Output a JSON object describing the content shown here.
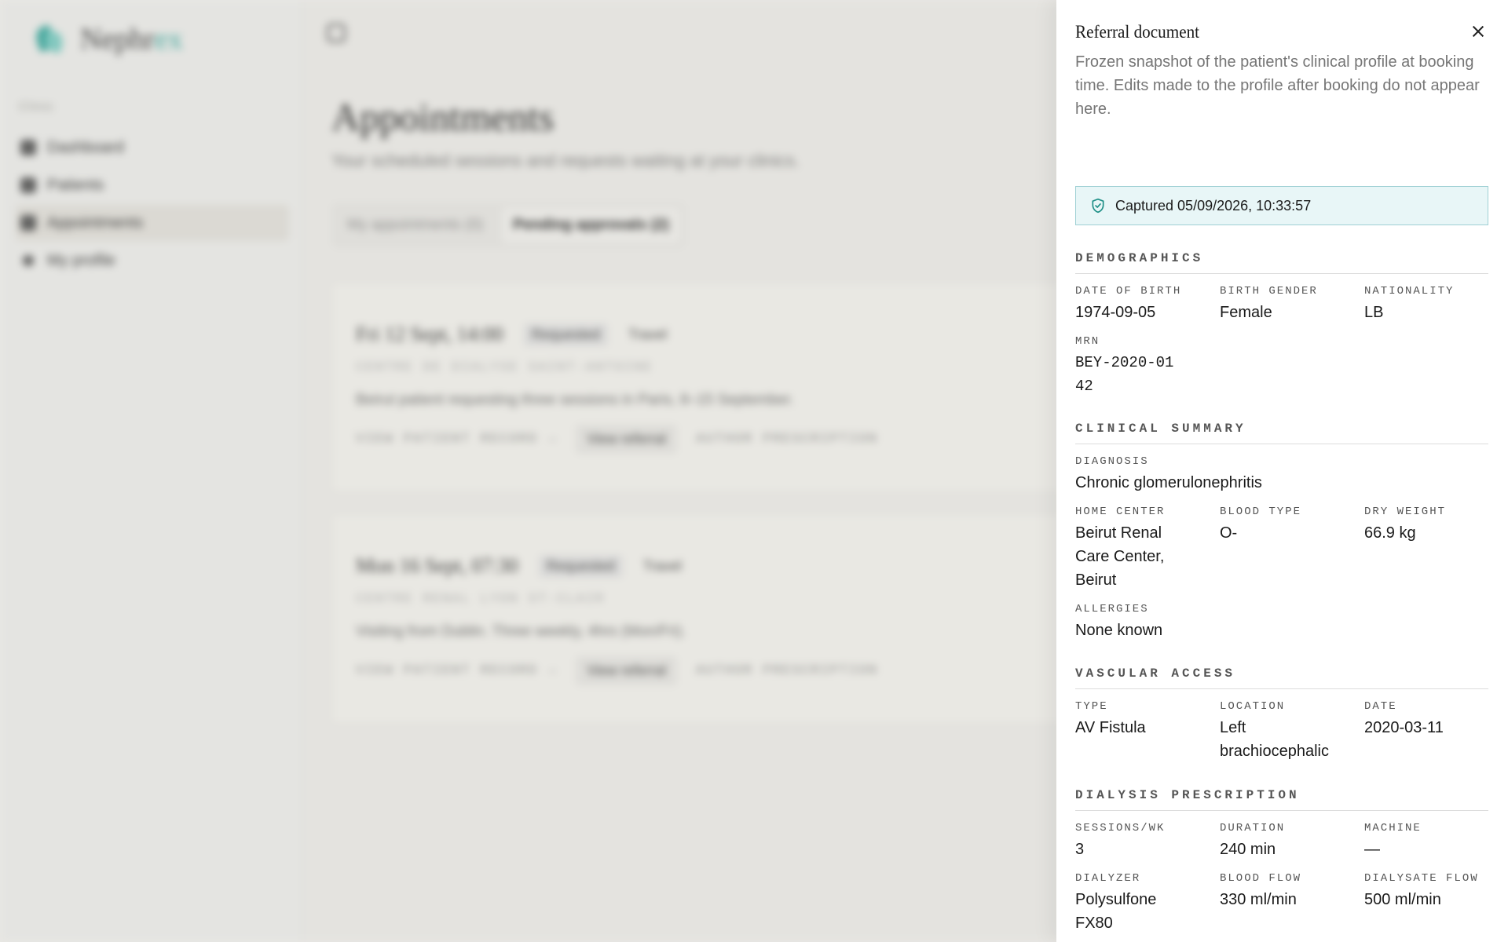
{
  "brand": {
    "name_a": "Nephr",
    "name_b": "ex"
  },
  "sidebar": {
    "group": "Clinic",
    "items": [
      {
        "label": "Dashboard"
      },
      {
        "label": "Patients"
      },
      {
        "label": "Appointments"
      },
      {
        "label": "My profile"
      }
    ]
  },
  "main": {
    "title": "Appointments",
    "subtitle": "Your scheduled sessions and requests waiting at your clinics.",
    "tabs": [
      {
        "label": "My appointments (0)"
      },
      {
        "label": "Pending approvals (2)"
      }
    ],
    "cards": [
      {
        "date": "Fri 12 Sept, 14:00",
        "status": "Requested",
        "tag": "Travel",
        "clinic": "CENTRE DE DIALYSE SAINT-ANTOINE",
        "note": "Beirut patient requesting three sessions in Paris, 8–15 September.",
        "view_record": "VIEW PATIENT RECORD →",
        "view_referral": "View referral",
        "author_prescription": "AUTHOR PRESCRIPTION"
      },
      {
        "date": "Mon 16 Sept, 07:30",
        "status": "Requested",
        "tag": "Travel",
        "clinic": "CENTRE RENAL LYON ST-CLAIR",
        "note": "Visiting from Dublin. Three weekly, 4hrs (Mon/Fri).",
        "view_record": "VIEW PATIENT RECORD →",
        "view_referral": "View referral",
        "author_prescription": "AUTHOR PRESCRIPTION"
      }
    ]
  },
  "drawer": {
    "title": "Referral document",
    "description": "Frozen snapshot of the patient's clinical profile at booking time. Edits made to the profile after booking do not appear here.",
    "captured": "Captured 05/09/2026, 10:33:57",
    "sections": {
      "demographics": {
        "heading": "DEMOGRAPHICS",
        "fields": [
          {
            "label": "DATE OF BIRTH",
            "value": "1974-09-05"
          },
          {
            "label": "BIRTH GENDER",
            "value": "Female"
          },
          {
            "label": "NATIONALITY",
            "value": "LB"
          },
          {
            "label": "MRN",
            "value": "BEY-2020-0142"
          }
        ]
      },
      "clinical": {
        "heading": "CLINICAL SUMMARY",
        "fields": [
          {
            "label": "DIAGNOSIS",
            "value": "Chronic glomerulonephritis"
          },
          {
            "label": "HOME CENTER",
            "value": "Beirut Renal Care Center, Beirut"
          },
          {
            "label": "BLOOD TYPE",
            "value": "O-"
          },
          {
            "label": "DRY WEIGHT",
            "value": "66.9 kg"
          },
          {
            "label": "ALLERGIES",
            "value": "None known"
          }
        ]
      },
      "vascular": {
        "heading": "VASCULAR ACCESS",
        "fields": [
          {
            "label": "TYPE",
            "value": "AV Fistula"
          },
          {
            "label": "LOCATION",
            "value": "Left brachiocephalic"
          },
          {
            "label": "DATE",
            "value": "2020-03-11"
          }
        ]
      },
      "prescription": {
        "heading": "DIALYSIS PRESCRIPTION",
        "fields": [
          {
            "label": "SESSIONS/WK",
            "value": "3"
          },
          {
            "label": "DURATION",
            "value": "240 min"
          },
          {
            "label": "MACHINE",
            "value": "—"
          },
          {
            "label": "DIALYZER",
            "value": "Polysulfone FX80"
          },
          {
            "label": "BLOOD FLOW",
            "value": "330 ml/min"
          },
          {
            "label": "DIALYSATE FLOW",
            "value": "500 ml/min"
          }
        ]
      }
    }
  }
}
